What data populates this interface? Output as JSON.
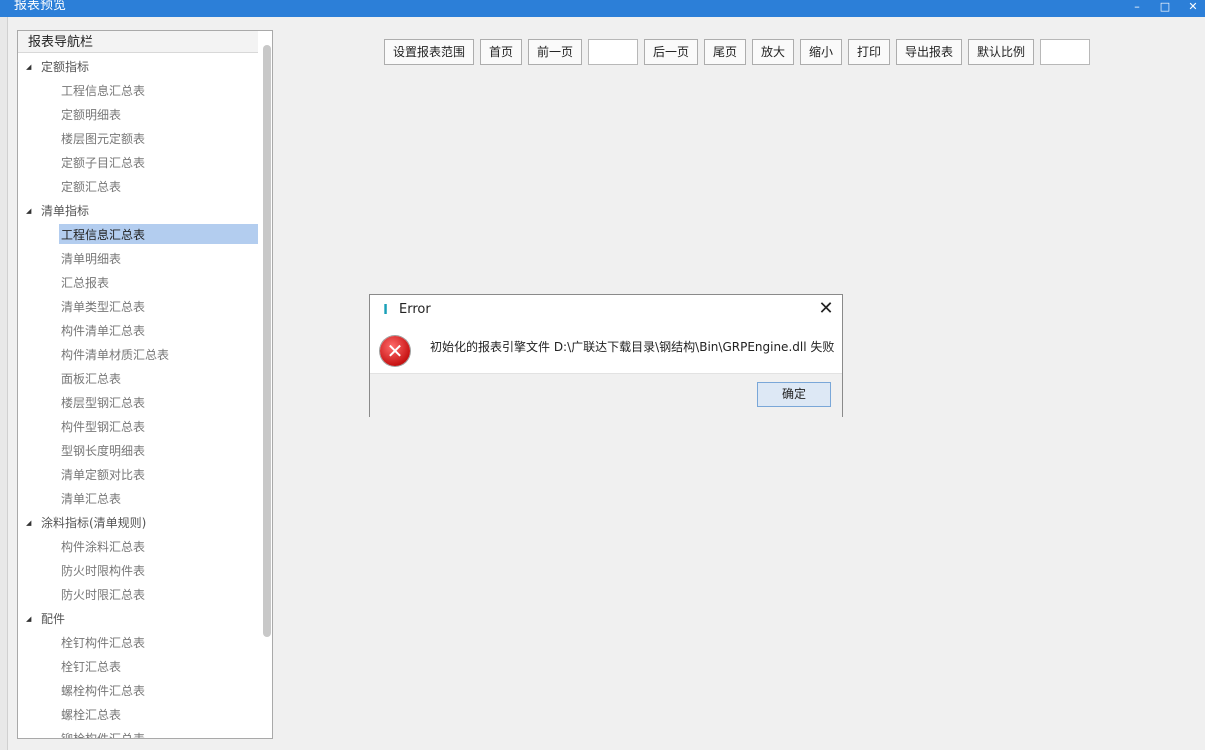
{
  "window": {
    "title": "报表预览",
    "minimize_icon": "minimize-icon",
    "maximize_icon": "maximize-icon",
    "close_icon": "close-icon"
  },
  "nav": {
    "header": "报表导航栏",
    "groups": [
      {
        "label": "定额指标",
        "items": [
          "工程信息汇总表",
          "定额明细表",
          "楼层图元定额表",
          "定额子目汇总表",
          "定额汇总表"
        ]
      },
      {
        "label": "清单指标",
        "items": [
          "工程信息汇总表",
          "清单明细表",
          "汇总报表",
          "清单类型汇总表",
          "构件清单汇总表",
          "构件清单材质汇总表",
          "面板汇总表",
          "楼层型钢汇总表",
          "构件型钢汇总表",
          "型钢长度明细表",
          "清单定额对比表",
          "清单汇总表"
        ]
      },
      {
        "label": "涂料指标(清单规则)",
        "items": [
          "构件涂料汇总表",
          "防火时限构件表",
          "防火时限汇总表"
        ]
      },
      {
        "label": "配件",
        "items": [
          "栓钉构件汇总表",
          "栓钉汇总表",
          "螺栓构件汇总表",
          "螺栓汇总表",
          "铆栓构件汇总表"
        ]
      }
    ],
    "selected": "清单指标/工程信息汇总表"
  },
  "toolbar": {
    "set_range": "设置报表范围",
    "first_page": "首页",
    "prev_page": "前一页",
    "page_input": "",
    "next_page": "后一页",
    "last_page": "尾页",
    "zoom_in": "放大",
    "zoom_out": "缩小",
    "print": "打印",
    "export": "导出报表",
    "default_scale": "默认比例",
    "scale_input": ""
  },
  "dialog": {
    "title": "Error",
    "message": "初始化的报表引擎文件 D:\\广联达下载目录\\钢结构\\Bin\\GRPEngine.dll 失败",
    "ok": "确定",
    "icon": "error-icon"
  }
}
